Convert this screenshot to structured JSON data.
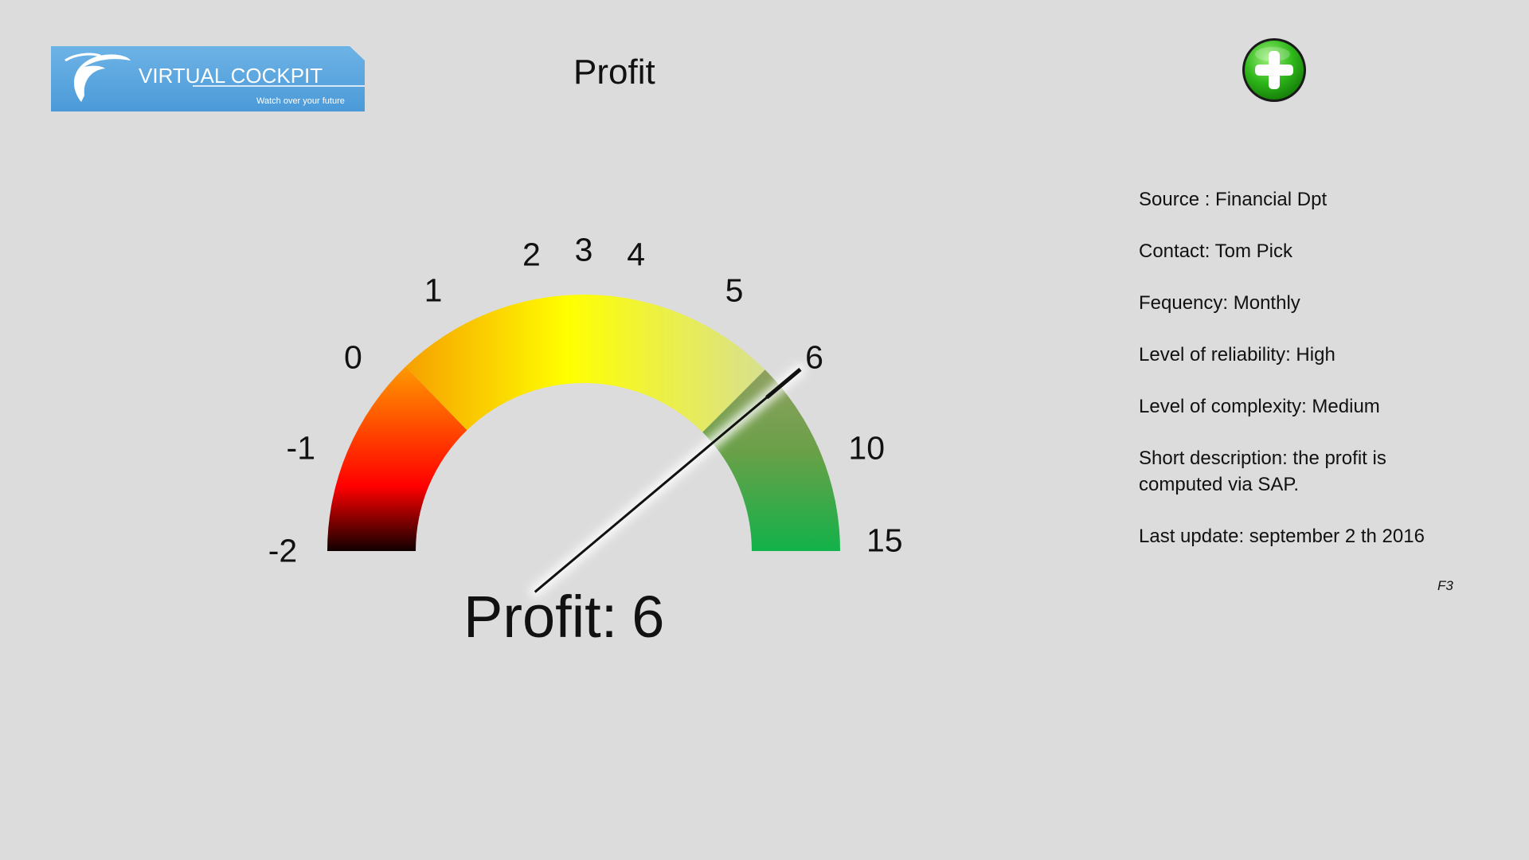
{
  "header": {
    "logo_text": "VIRTUAL COCKPIT",
    "logo_tagline": "Watch over your future",
    "title": "Profit",
    "add_button_icon": "plus-circle-icon"
  },
  "gauge": {
    "labels": [
      "-2",
      "-1",
      "0",
      "1",
      "2",
      "3",
      "4",
      "5",
      "6",
      "10",
      "15"
    ],
    "value": 6,
    "readout_label": "Profit:",
    "readout_value": "6",
    "colors": {
      "low": "#100000",
      "red": "#ff0000",
      "orange": "#ff9900",
      "yellow": "#ffff00",
      "pale": "#dfe6a0",
      "green": "#12b24a"
    }
  },
  "info": {
    "source": "Source : Financial Dpt",
    "contact": "Contact: Tom Pick",
    "frequency": "Fequency: Monthly",
    "reliability": "Level of reliability: High",
    "complexity": "Level of complexity: Medium",
    "description_line1": "Short description:  the profit is",
    "description_line2": "computed via SAP.",
    "last_update": "Last update:  september 2 th 2016"
  },
  "footer": {
    "page_id": "F3"
  }
}
